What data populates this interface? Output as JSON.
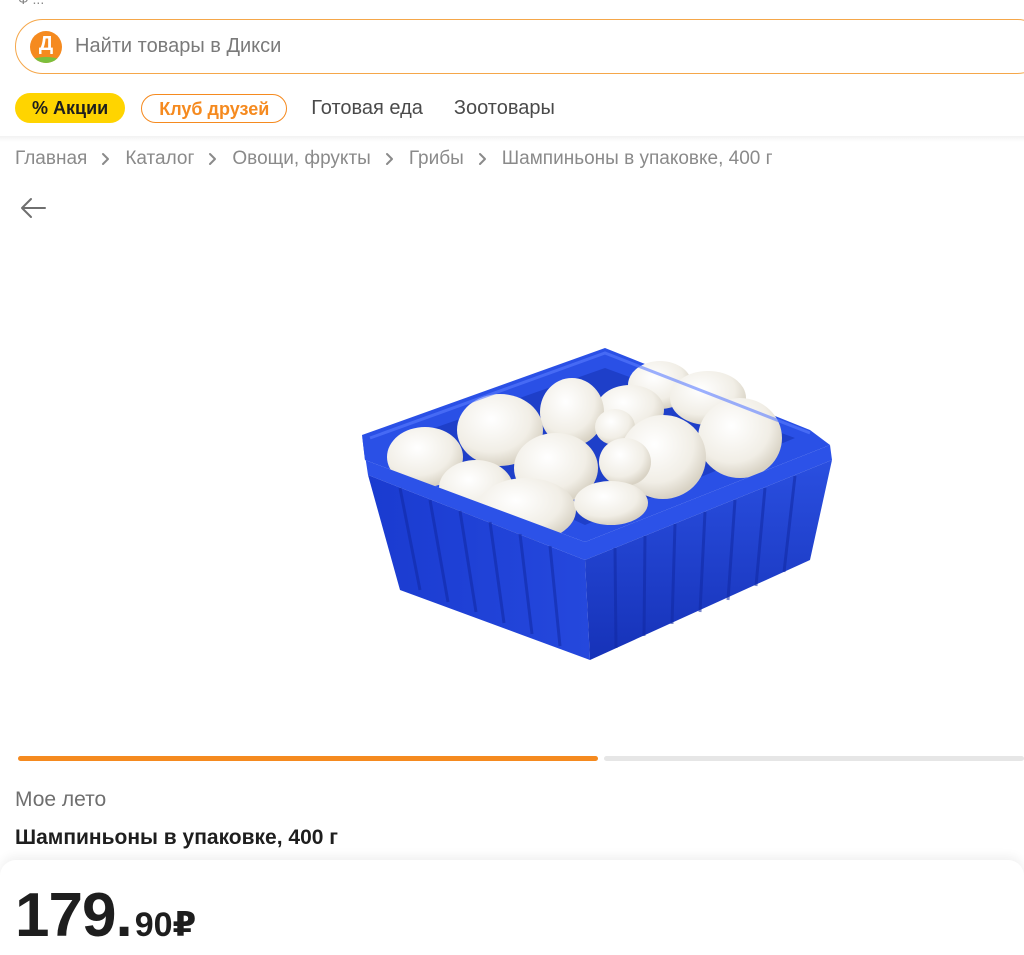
{
  "search": {
    "logo_letter": "Д",
    "placeholder": "Найти товары в Дикси"
  },
  "nav": {
    "promo_label": "% Акции",
    "club_label": "Клуб друзей",
    "links": [
      "Готовая еда",
      "Зоотовары"
    ]
  },
  "breadcrumb": [
    "Главная",
    "Каталог",
    "Овощи, фрукты",
    "Грибы",
    "Шампиньоны в упаковке, 400 г"
  ],
  "product": {
    "brand": "Мое лето",
    "title": "Шампиньоны в упаковке, 400 г",
    "price_int": "179",
    "price_sep": ".",
    "price_frac": "90",
    "currency": "₽"
  },
  "gallery": {
    "progress_fraction": 0.58
  },
  "colors": {
    "accent": "#f58a1f",
    "promo_yellow": "#ffd400",
    "tray_blue": "#1f3fd1"
  }
}
